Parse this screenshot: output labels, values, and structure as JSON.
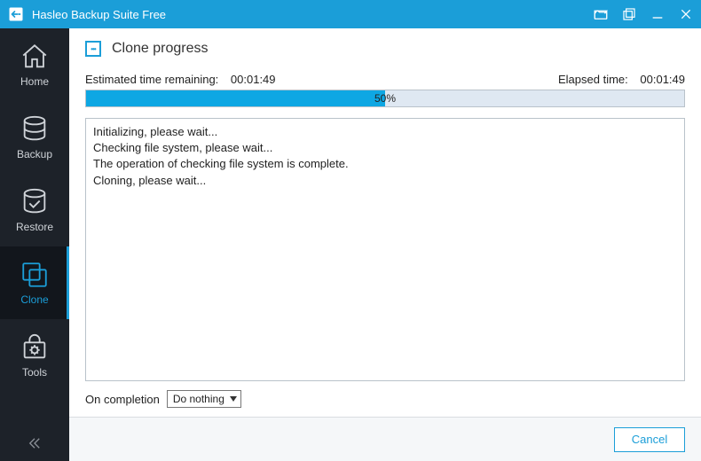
{
  "titlebar": {
    "title": "Hasleo Backup Suite Free"
  },
  "sidebar": {
    "items": [
      {
        "label": "Home"
      },
      {
        "label": "Backup"
      },
      {
        "label": "Restore"
      },
      {
        "label": "Clone"
      },
      {
        "label": "Tools"
      }
    ],
    "active_index": 3
  },
  "main": {
    "title": "Clone progress",
    "estimated_label": "Estimated time remaining:",
    "estimated_value": "00:01:49",
    "elapsed_label": "Elapsed time:",
    "elapsed_value": "00:01:49",
    "progress_percent": 50,
    "progress_label": "50%",
    "log_lines": [
      "Initializing, please wait...",
      "Checking file system, please wait...",
      "The operation of checking file system is complete.",
      "Cloning, please wait..."
    ],
    "completion_label": "On completion",
    "completion_selected": "Do nothing"
  },
  "footer": {
    "cancel_label": "Cancel"
  },
  "colors": {
    "accent": "#1b9ed8",
    "sidebar_bg": "#1d2229"
  }
}
